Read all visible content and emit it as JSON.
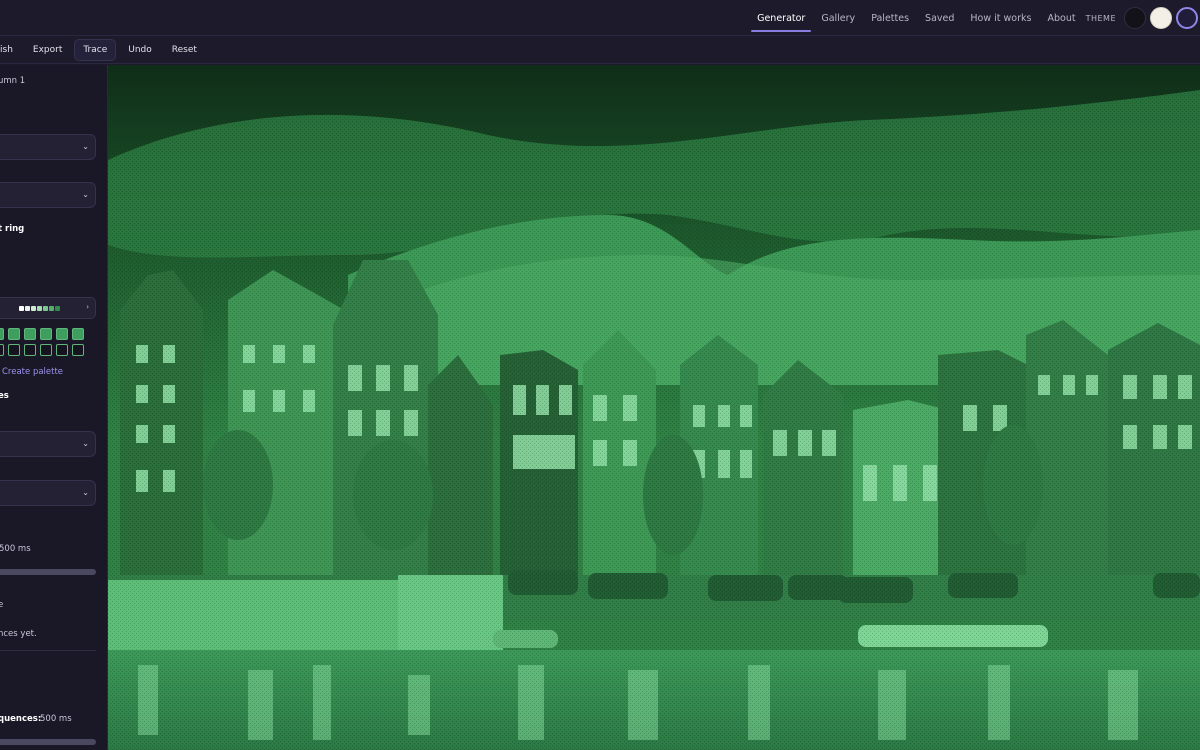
{
  "nav": {
    "items": [
      "Generator",
      "Gallery",
      "Palettes",
      "Saved",
      "How it works",
      "About"
    ],
    "theme_label": "THEME"
  },
  "toolbar": {
    "publish": "ish",
    "export": "Export",
    "trace": "Trace",
    "undo": "Undo",
    "reset": "Reset"
  },
  "sidebar": {
    "column_label": "umn 1",
    "ring_label": "t ring",
    "create_palette": "Create palette",
    "section_fragment": "es",
    "speed_value": "500 ms",
    "e_fragment": "e",
    "empty_state": "nces yet.",
    "sequences_label": "quences:",
    "sequences_value": "500 ms",
    "palette_colors": [
      "#ffffff",
      "#e8f5ea",
      "#cfead5",
      "#a9dbb4",
      "#7cc88e",
      "#52b06a",
      "#2f8c49"
    ],
    "chevron": "⌄"
  },
  "colors": {
    "accent": "#8a7de0",
    "canvas_green": "#3d9e5e"
  }
}
